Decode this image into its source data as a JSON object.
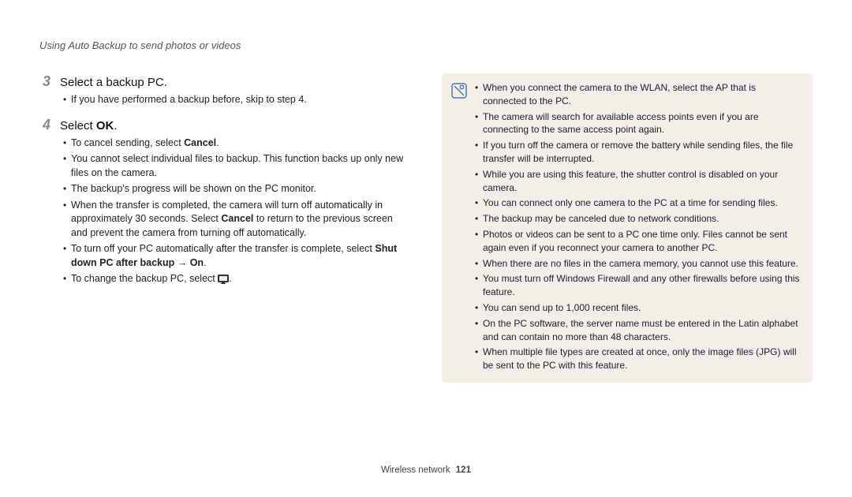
{
  "header": {
    "title": "Using Auto Backup to send photos or videos"
  },
  "steps": {
    "s3": {
      "num": "3",
      "title": "Select a backup PC.",
      "items": [
        "If you have performed a backup before, skip to step 4."
      ]
    },
    "s4": {
      "num": "4",
      "title_pre": "Select ",
      "title_bold": "OK",
      "title_post": ".",
      "i0_pre": "To cancel sending, select ",
      "i0_bold": "Cancel",
      "i0_post": ".",
      "i1": "You cannot select individual files to backup. This function backs up only new files on the camera.",
      "i2": "The backup's progress will be shown on the PC monitor.",
      "i3_pre": "When the transfer is completed, the camera will turn off automatically in approximately 30 seconds. Select ",
      "i3_bold": "Cancel",
      "i3_post": " to return to the previous screen and prevent the camera from turning off automatically.",
      "i4_pre": "To turn off your PC automatically after the transfer is complete, select ",
      "i4_bold": "Shut down PC after backup → On",
      "i4_post": ".",
      "i5_pre": "To change the backup PC, select ",
      "i5_post": "."
    }
  },
  "notes": {
    "n0": "When you connect the camera to the WLAN, select the AP that is connected to the PC.",
    "n1": "The camera will search for available access points even if you are connecting to the same access point again.",
    "n2": "If you turn off the camera or remove the battery while sending files, the file transfer will be interrupted.",
    "n3": "While you are using this feature, the shutter control is disabled on your camera.",
    "n4": "You can connect only one camera to the PC at a time for sending files.",
    "n5": "The backup may be canceled due to network conditions.",
    "n6": "Photos or videos can be sent to a PC one time only. Files cannot be sent again even if you reconnect your camera to another PC.",
    "n7": "When there are no files in the camera memory, you cannot use this feature.",
    "n8": "You must turn off Windows Firewall and any other firewalls before using this feature.",
    "n9": "You can send up to 1,000 recent files.",
    "n10": "On the PC software, the server name must be entered in the Latin alphabet and can contain no more than 48 characters.",
    "n11": "When multiple file types are created at once, only the image files (JPG) will be sent to the PC with this feature."
  },
  "footer": {
    "label": "Wireless network",
    "page": "121"
  }
}
